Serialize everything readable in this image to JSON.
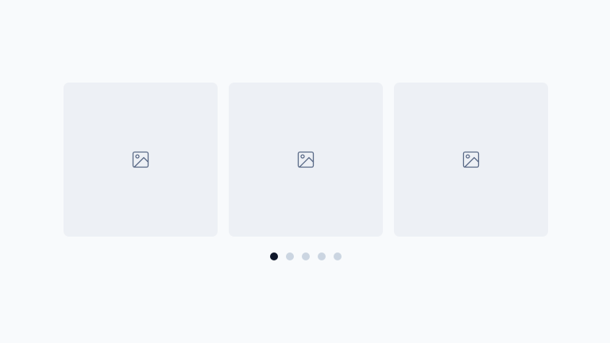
{
  "colors": {
    "page_background": "#f8fafc",
    "slide_background": "#edf0f5",
    "icon_stroke": "#5a6a87",
    "dot_active": "#0f172a",
    "dot_inactive": "#cbd5e1"
  },
  "carousel": {
    "slides": [
      {
        "icon": "image-placeholder-icon"
      },
      {
        "icon": "image-placeholder-icon"
      },
      {
        "icon": "image-placeholder-icon"
      }
    ],
    "pagination": {
      "total_pages": 5,
      "active_page": 1
    }
  }
}
